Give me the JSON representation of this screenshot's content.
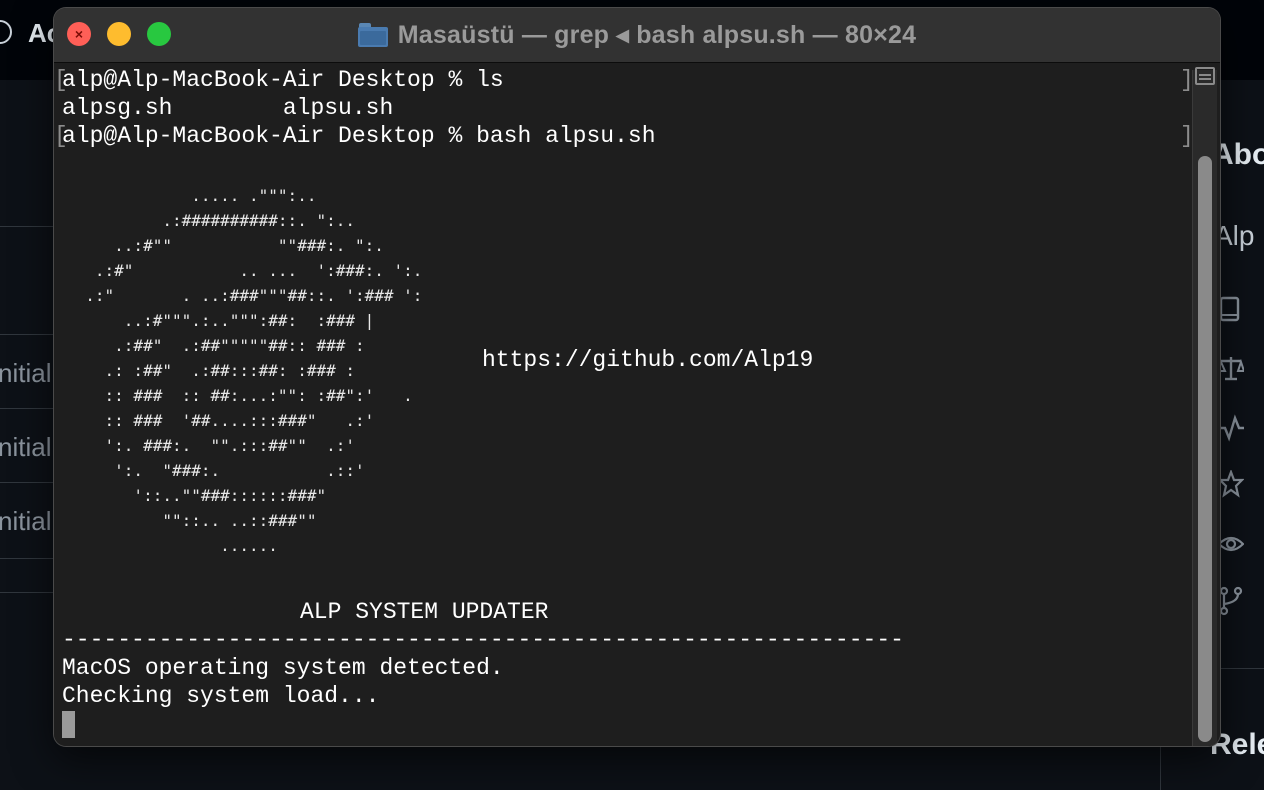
{
  "background": {
    "top_text": "Ac",
    "commit_rows": [
      "nitial",
      "nitial",
      "nitial"
    ],
    "right_panel": {
      "about": "Abo",
      "owner": "Alp",
      "releases": "Rele"
    },
    "icons": [
      "book-icon",
      "scale-icon",
      "pulse-icon",
      "star-icon",
      "eye-icon",
      "fork-icon"
    ]
  },
  "window": {
    "title": "Masaüstü — grep ◂ bash alpsu.sh — 80×24",
    "folder_icon": "folder-icon"
  },
  "terminal": {
    "prompt1": "alp@Alp-MacBook-Air Desktop % ls",
    "ls_output": "alpsg.sh        alpsu.sh",
    "prompt2": "alp@Alp-MacBook-Air Desktop % bash alpsu.sh",
    "ascii_logo": "             ..... .\"\"\":..\n          .:##########::. \":..\n     ..:#\"\"           \"\"###:. \":.\n   .:#\"           .. ...  ':###:. ':.\n  .:\"       . ..:###\"\"\"##::. ':### ':\n      ..:#\"\"\".:..\"\"\":##:  :### |\n     .:##\"  .:##\"\"\"\"\"##:: ### :\n    .: :##\"  .:##:::##: :### :\n    :: ###  :: ##:...:\"\": :##\":'   .\n    :: ###  '##....:::###\"   .:'\n    ':. ###:.  \"\".:::##\"\"  .:'\n     ':.  \"###:.           .::'\n       '::..\"\"###::::::###\"\n          \"\"::.. ..::###\"\"\n                ......",
    "url": "https://github.com/Alp19",
    "heading": "ALP SYSTEM UPDATER",
    "separator": "-------------------------------------------------------------",
    "status1": "MacOS operating system detected.",
    "status2": "Checking system load..."
  }
}
